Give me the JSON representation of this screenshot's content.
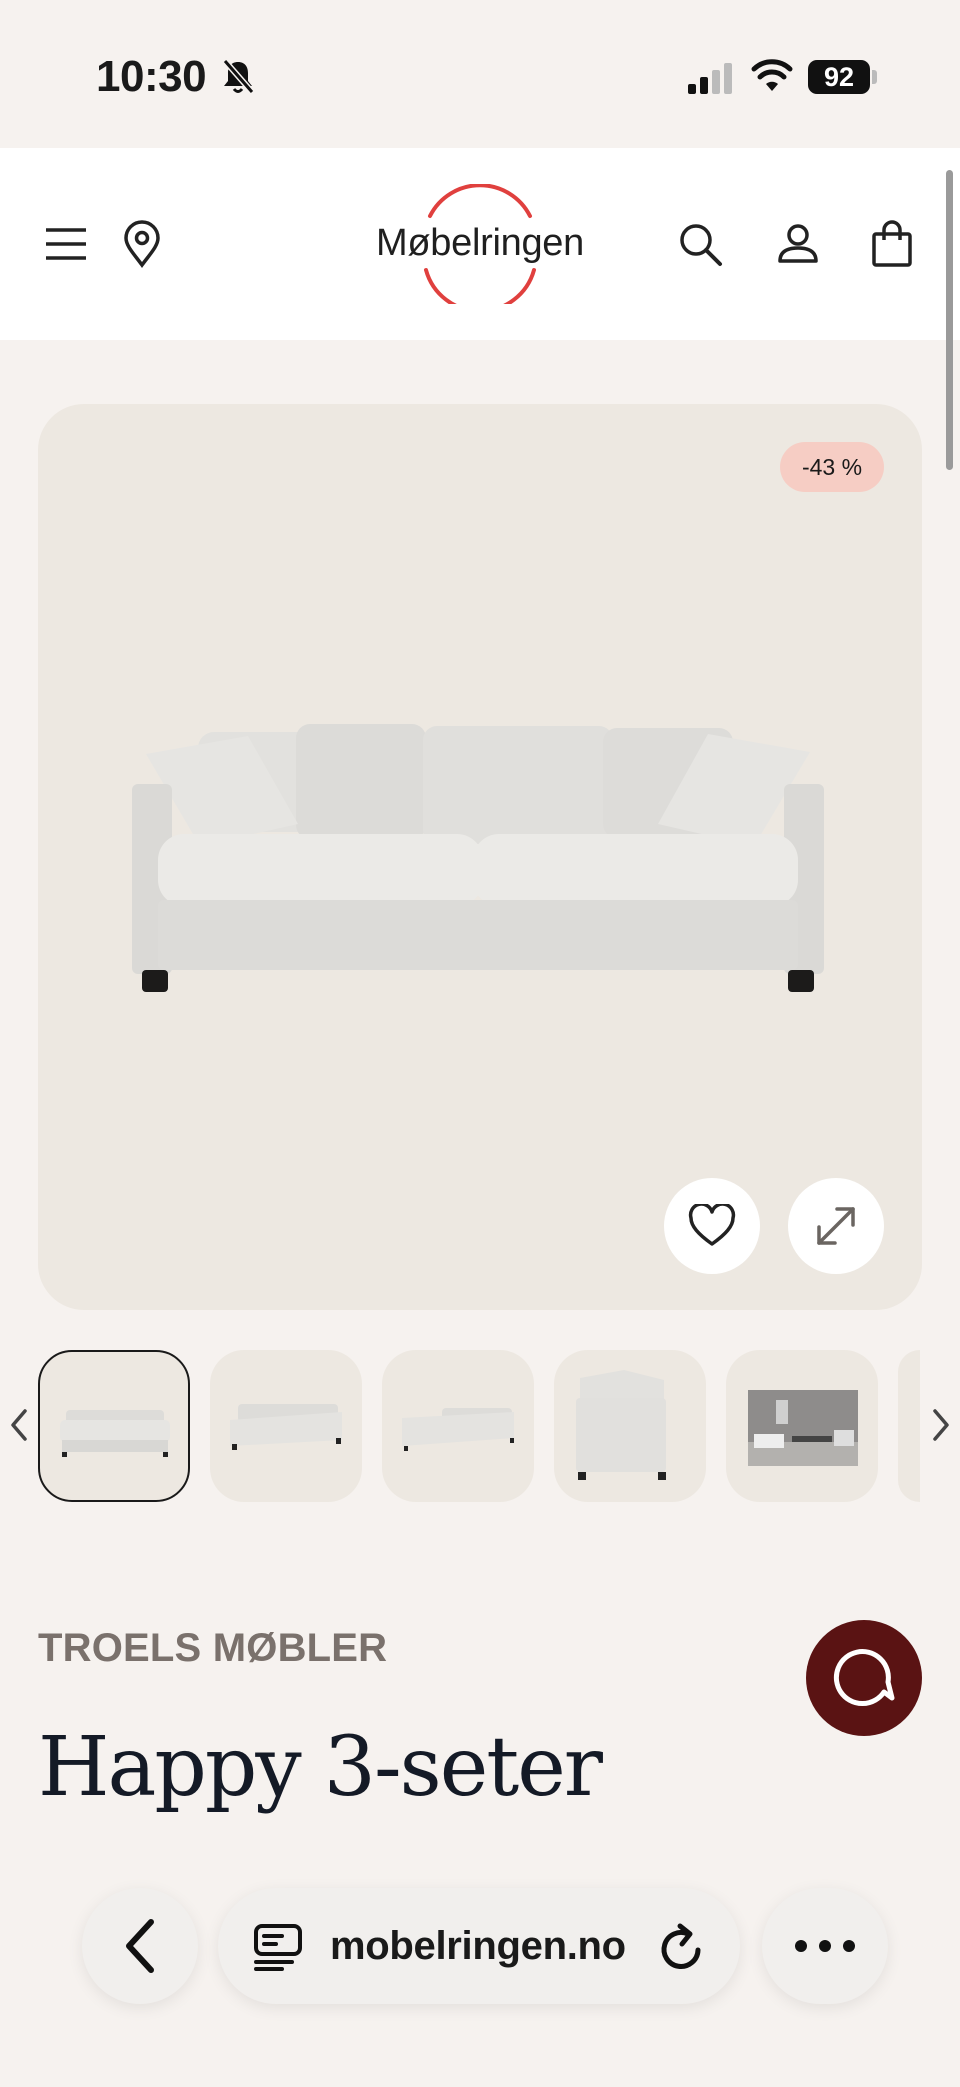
{
  "status_bar": {
    "time": "10:30",
    "battery": "92",
    "icons": [
      "bell-slash-icon",
      "signal-icon",
      "wifi-icon",
      "battery-icon"
    ]
  },
  "header": {
    "logo_text": "Møbelringen",
    "icons": [
      "menu-icon",
      "location-icon",
      "search-icon",
      "account-icon",
      "cart-icon"
    ],
    "accent_color": "#e0403e"
  },
  "product": {
    "discount_badge": "-43 %",
    "brand": "TROELS MØBLER",
    "title": "Happy 3-seter",
    "image_buttons": [
      "heart-icon",
      "expand-icon"
    ]
  },
  "thumbnails": {
    "count_visible": 5,
    "selected_index": 0
  },
  "chat": {
    "icon": "chat-icon",
    "color": "#5a1313"
  },
  "browser": {
    "url": "mobelringen.no",
    "icons": [
      "back-icon",
      "tabs-icon",
      "reload-icon",
      "more-icon"
    ]
  }
}
